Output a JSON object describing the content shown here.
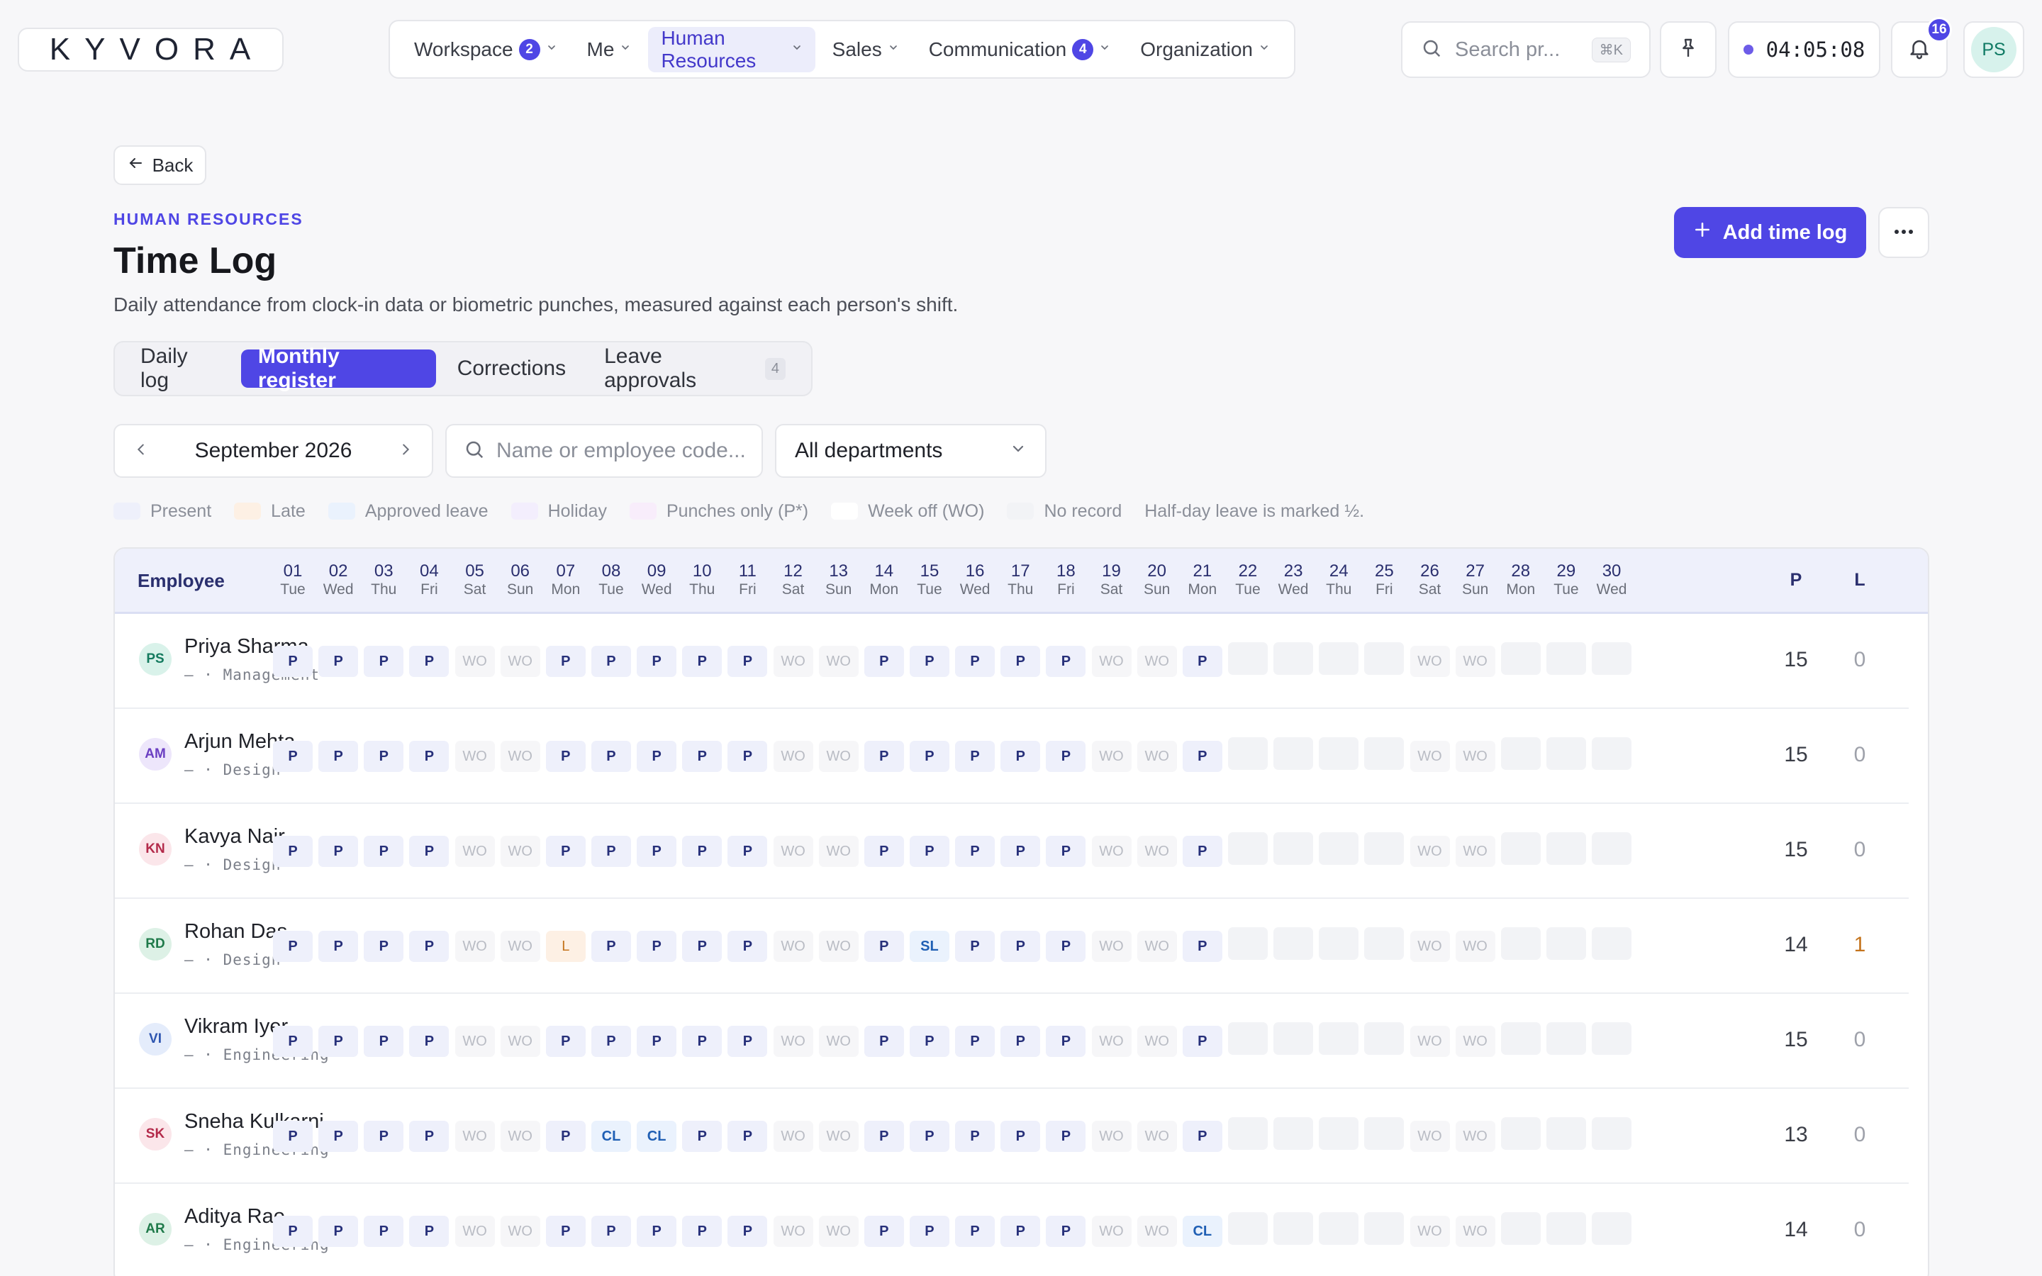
{
  "brand": {
    "logo_text": "KYVORA"
  },
  "nav": {
    "items": [
      {
        "label": "Workspace",
        "badge": "2",
        "active": false
      },
      {
        "label": "Me",
        "badge": "",
        "active": false
      },
      {
        "label": "Human Resources",
        "badge": "",
        "active": true
      },
      {
        "label": "Sales",
        "badge": "",
        "active": false
      },
      {
        "label": "Communication",
        "badge": "4",
        "active": false
      },
      {
        "label": "Organization",
        "badge": "",
        "active": false
      }
    ]
  },
  "topbar": {
    "search_placeholder": "Search pr...",
    "search_shortcut": "⌘K",
    "timer": "04:05:08",
    "notification_count": "16",
    "user_initials": "PS"
  },
  "header": {
    "back_label": "Back",
    "eyebrow": "HUMAN RESOURCES",
    "title": "Time Log",
    "subtitle": "Daily attendance from clock-in data or biometric punches, measured against each person's shift.",
    "add_label": "Add time log"
  },
  "tabs": [
    {
      "label": "Daily log",
      "count": "",
      "active": false
    },
    {
      "label": "Monthly register",
      "count": "",
      "active": true
    },
    {
      "label": "Corrections",
      "count": "",
      "active": false
    },
    {
      "label": "Leave approvals",
      "count": "4",
      "active": false
    }
  ],
  "filters": {
    "month": "September 2026",
    "search_placeholder": "Name or employee code...",
    "department": "All departments"
  },
  "legend": {
    "items": [
      {
        "label": "Present",
        "color": "#eef0fb"
      },
      {
        "label": "Late",
        "color": "#fdf0e4"
      },
      {
        "label": "Approved leave",
        "color": "#eaf2fd"
      },
      {
        "label": "Holiday",
        "color": "#f3eefd"
      },
      {
        "label": "Punches only (P*)",
        "color": "#f8edfb"
      },
      {
        "label": "Week off (WO)",
        "color": "#ffffff"
      },
      {
        "label": "No record",
        "color": "#f2f3f6"
      }
    ],
    "note": "Half-day leave is marked ½."
  },
  "register": {
    "employee_header": "Employee",
    "days": [
      {
        "d": "01",
        "w": "Tue"
      },
      {
        "d": "02",
        "w": "Wed"
      },
      {
        "d": "03",
        "w": "Thu"
      },
      {
        "d": "04",
        "w": "Fri"
      },
      {
        "d": "05",
        "w": "Sat"
      },
      {
        "d": "06",
        "w": "Sun"
      },
      {
        "d": "07",
        "w": "Mon"
      },
      {
        "d": "08",
        "w": "Tue"
      },
      {
        "d": "09",
        "w": "Wed"
      },
      {
        "d": "10",
        "w": "Thu"
      },
      {
        "d": "11",
        "w": "Fri"
      },
      {
        "d": "12",
        "w": "Sat"
      },
      {
        "d": "13",
        "w": "Sun"
      },
      {
        "d": "14",
        "w": "Mon"
      },
      {
        "d": "15",
        "w": "Tue"
      },
      {
        "d": "16",
        "w": "Wed"
      },
      {
        "d": "17",
        "w": "Thu"
      },
      {
        "d": "18",
        "w": "Fri"
      },
      {
        "d": "19",
        "w": "Sat"
      },
      {
        "d": "20",
        "w": "Sun"
      },
      {
        "d": "21",
        "w": "Mon"
      },
      {
        "d": "22",
        "w": "Tue"
      },
      {
        "d": "23",
        "w": "Wed"
      },
      {
        "d": "24",
        "w": "Thu"
      },
      {
        "d": "25",
        "w": "Fri"
      },
      {
        "d": "26",
        "w": "Sat"
      },
      {
        "d": "27",
        "w": "Sun"
      },
      {
        "d": "28",
        "w": "Mon"
      },
      {
        "d": "29",
        "w": "Tue"
      },
      {
        "d": "30",
        "w": "Wed"
      }
    ],
    "total_headers": [
      "P",
      "L"
    ],
    "rows": [
      {
        "initials": "PS",
        "name": "Priya Sharma",
        "meta": "— · Management",
        "avatar_bg": "#d9f2ea",
        "avatar_fg": "#137a5e",
        "cells": [
          "P",
          "P",
          "P",
          "P",
          "WO",
          "WO",
          "P",
          "P",
          "P",
          "P",
          "P",
          "WO",
          "WO",
          "P",
          "P",
          "P",
          "P",
          "P",
          "WO",
          "WO",
          "P",
          "",
          "",
          "",
          "",
          "WO",
          "WO",
          "",
          "",
          ""
        ],
        "p": "15",
        "l": "0"
      },
      {
        "initials": "AM",
        "name": "Arjun Mehta",
        "meta": "— · Design",
        "avatar_bg": "#ede6fb",
        "avatar_fg": "#6b3fc2",
        "cells": [
          "P",
          "P",
          "P",
          "P",
          "WO",
          "WO",
          "P",
          "P",
          "P",
          "P",
          "P",
          "WO",
          "WO",
          "P",
          "P",
          "P",
          "P",
          "P",
          "WO",
          "WO",
          "P",
          "",
          "",
          "",
          "",
          "WO",
          "WO",
          "",
          "",
          ""
        ],
        "p": "15",
        "l": "0"
      },
      {
        "initials": "KN",
        "name": "Kavya Nair",
        "meta": "— · Design",
        "avatar_bg": "#fbe6ea",
        "avatar_fg": "#b32a4a",
        "cells": [
          "P",
          "P",
          "P",
          "P",
          "WO",
          "WO",
          "P",
          "P",
          "P",
          "P",
          "P",
          "WO",
          "WO",
          "P",
          "P",
          "P",
          "P",
          "P",
          "WO",
          "WO",
          "P",
          "",
          "",
          "",
          "",
          "WO",
          "WO",
          "",
          "",
          ""
        ],
        "p": "15",
        "l": "0"
      },
      {
        "initials": "RD",
        "name": "Rohan Das",
        "meta": "— · Design",
        "avatar_bg": "#ddf1e6",
        "avatar_fg": "#1f7a4a",
        "cells": [
          "P",
          "P",
          "P",
          "P",
          "WO",
          "WO",
          "L",
          "P",
          "P",
          "P",
          "P",
          "WO",
          "WO",
          "P",
          "SL",
          "P",
          "P",
          "P",
          "WO",
          "WO",
          "P",
          "",
          "",
          "",
          "",
          "WO",
          "WO",
          "",
          "",
          ""
        ],
        "p": "14",
        "l": "1"
      },
      {
        "initials": "VI",
        "name": "Vikram Iyer",
        "meta": "— · Engineering",
        "avatar_bg": "#e4ecfb",
        "avatar_fg": "#2d55b0",
        "cells": [
          "P",
          "P",
          "P",
          "P",
          "WO",
          "WO",
          "P",
          "P",
          "P",
          "P",
          "P",
          "WO",
          "WO",
          "P",
          "P",
          "P",
          "P",
          "P",
          "WO",
          "WO",
          "P",
          "",
          "",
          "",
          "",
          "WO",
          "WO",
          "",
          "",
          ""
        ],
        "p": "15",
        "l": "0"
      },
      {
        "initials": "SK",
        "name": "Sneha Kulkarni",
        "meta": "— · Engineering",
        "avatar_bg": "#fbe6ea",
        "avatar_fg": "#b32a4a",
        "cells": [
          "P",
          "P",
          "P",
          "P",
          "WO",
          "WO",
          "P",
          "CL",
          "CL",
          "P",
          "P",
          "WO",
          "WO",
          "P",
          "P",
          "P",
          "P",
          "P",
          "WO",
          "WO",
          "P",
          "",
          "",
          "",
          "",
          "WO",
          "WO",
          "",
          "",
          ""
        ],
        "p": "13",
        "l": "0"
      },
      {
        "initials": "AR",
        "name": "Aditya Rao",
        "meta": "— · Engineering",
        "avatar_bg": "#ddf1e6",
        "avatar_fg": "#1f7a4a",
        "cells": [
          "P",
          "P",
          "P",
          "P",
          "WO",
          "WO",
          "P",
          "P",
          "P",
          "P",
          "P",
          "WO",
          "WO",
          "P",
          "P",
          "P",
          "P",
          "P",
          "WO",
          "WO",
          "CL",
          "",
          "",
          "",
          "",
          "WO",
          "WO",
          "",
          "",
          ""
        ],
        "p": "14",
        "l": "0"
      }
    ]
  }
}
